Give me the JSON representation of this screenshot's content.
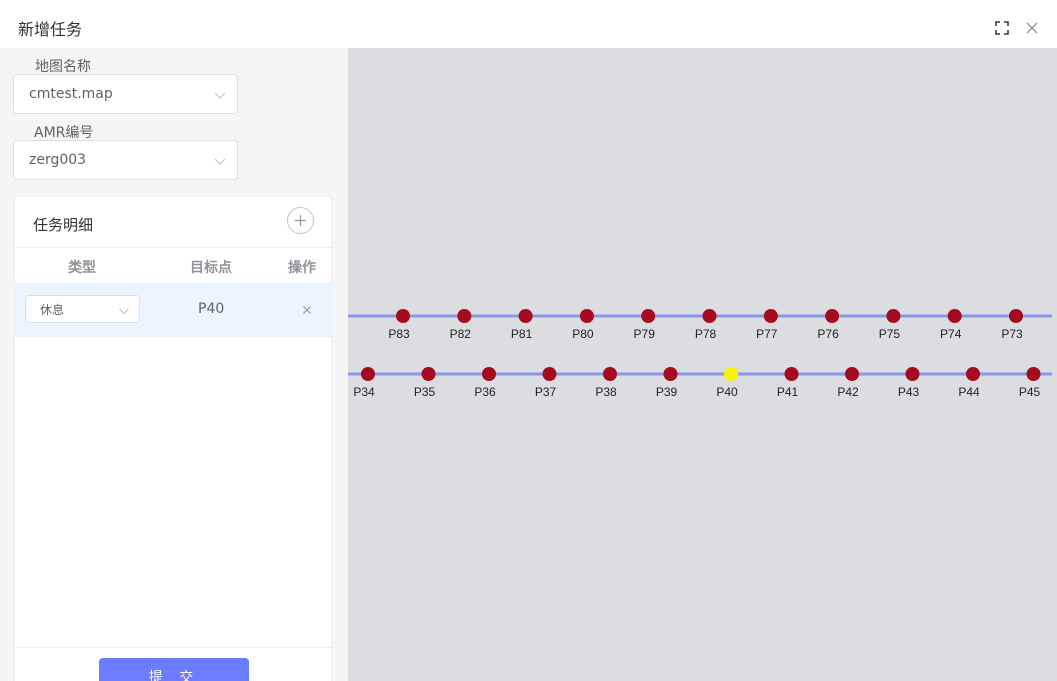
{
  "dialog": {
    "title": "新增任务"
  },
  "form": {
    "map_label": "地图名称",
    "map_value": "cmtest.map",
    "amr_label": "AMR编号",
    "amr_value": "zerg003"
  },
  "task_detail": {
    "title": "任务明细",
    "columns": [
      "类型",
      "目标点",
      "操作"
    ],
    "rows": [
      {
        "type": "休息",
        "target": "P40",
        "action": "×"
      }
    ],
    "submit_label": "提 交"
  },
  "map": {
    "colors": {
      "line": "#8896ee",
      "point": "#a50b1f",
      "selected": "#f5f500",
      "background": "#dcdde1"
    },
    "selected_point": "P40",
    "rows": [
      {
        "name": "upper",
        "points": [
          "P83",
          "P82",
          "P81",
          "P80",
          "P79",
          "P78",
          "P77",
          "P76",
          "P75",
          "P74",
          "P73"
        ]
      },
      {
        "name": "lower",
        "points": [
          "P34",
          "P35",
          "P36",
          "P37",
          "P38",
          "P39",
          "P40",
          "P41",
          "P42",
          "P43",
          "P44",
          "P45"
        ]
      }
    ]
  }
}
